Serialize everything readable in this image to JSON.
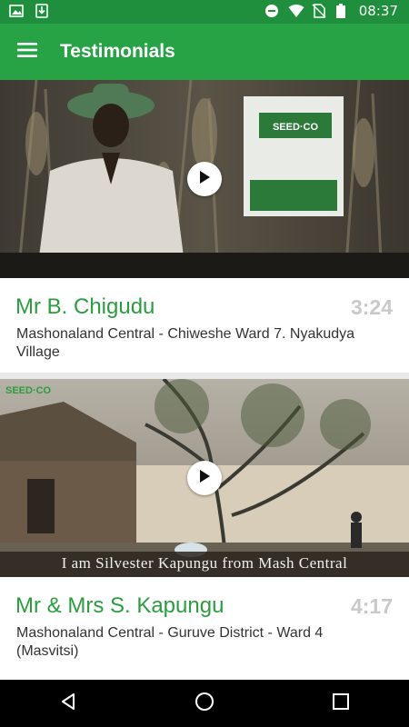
{
  "status_bar": {
    "time": "08:37",
    "left_icons": [
      "image-notification-icon",
      "download-notification-icon"
    ],
    "right_icons": [
      "do-not-disturb-icon",
      "wifi-icon",
      "no-sim-icon",
      "battery-icon"
    ]
  },
  "app_bar": {
    "title": "Testimonials",
    "menu_icon": "hamburger-menu-icon"
  },
  "testimonials": [
    {
      "name": "Mr B. Chigudu",
      "duration": "3:24",
      "location": "Mashonaland Central - Chiweshe Ward 7. Nyakudya Village",
      "video_caption": "",
      "sign_text": "SEED·CO"
    },
    {
      "name": "Mr & Mrs S. Kapungu",
      "duration": "4:17",
      "location": "Mashonaland Central - Guruve District - Ward 4 (Masvitsi)",
      "video_caption": "I am Silvester Kapungu from Mash Central",
      "watermark": "SEED·CO"
    }
  ],
  "colors": {
    "status_bar": "#1f8f3e",
    "app_bar": "#27a346",
    "name_text": "#2a9d3f",
    "duration_text": "#c9c9c9"
  }
}
